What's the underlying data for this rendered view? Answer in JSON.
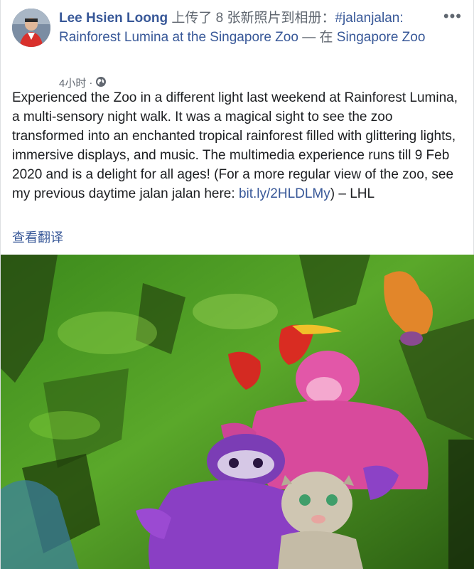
{
  "post": {
    "author": "Lee Hsien Loong",
    "action_text": " 上传了 8 张新照片到相册：",
    "album_link": "#jalanjalan: Rainforest Lumina at the Singapore Zoo",
    "location_sep": " — 在 ",
    "location_link": "Singapore Zoo",
    "timestamp": "4小时",
    "timestamp_sep": " · ",
    "privacy_icon": "globe-icon",
    "more_label": "•••",
    "body_main": "Experienced the Zoo in a different light last weekend at Rainforest Lumina, a multi-sensory night walk. It was a magical sight to see the zoo transformed into an enchanted tropical rainforest filled with glittering lights, immersive displays, and music. The multimedia experience runs till 9 Feb 2020 and is a delight for all ages! (For a more regular view of the zoo, see my previous daytime jalan jalan here: ",
    "body_link": "bit.ly/2HLDLMy",
    "body_end": ") – LHL",
    "translate_label": "查看翻译"
  },
  "colors": {
    "link": "#385898",
    "text": "#1c1e21",
    "meta": "#616770"
  }
}
